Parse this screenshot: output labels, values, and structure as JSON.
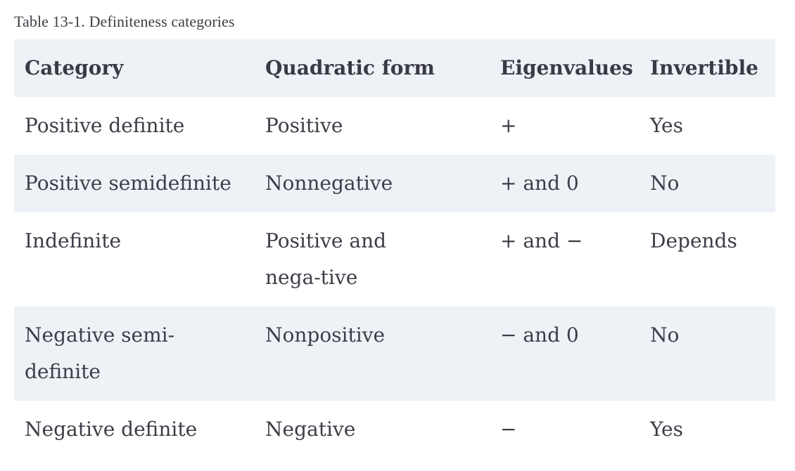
{
  "caption": "Table 13-1. Definiteness categories",
  "table": {
    "headers": [
      "Category",
      "Quadratic form",
      "Eigenvalues",
      "Invertible"
    ],
    "rows": [
      {
        "category": "Positive definite",
        "quadratic_form": "Positive",
        "eigenvalues": "+",
        "invertible": "Yes"
      },
      {
        "category": "Positive semidefinite",
        "quadratic_form": "Nonnegative",
        "eigenvalues": "+ and 0",
        "invertible": "No"
      },
      {
        "category": "Indefinite",
        "quadratic_form": "Positive and nega-tive",
        "eigenvalues": "+ and −",
        "invertible": "Depends"
      },
      {
        "category": "Negative semi-definite",
        "quadratic_form": "Nonpositive",
        "eigenvalues": "− and 0",
        "invertible": "No"
      },
      {
        "category": "Negative definite",
        "quadratic_form": "Negative",
        "eigenvalues": "−",
        "invertible": "Yes"
      }
    ]
  },
  "colors": {
    "header_bg": "#eef1f6",
    "stripe_bg": "#eef1f6",
    "text": "#3d3d47"
  }
}
